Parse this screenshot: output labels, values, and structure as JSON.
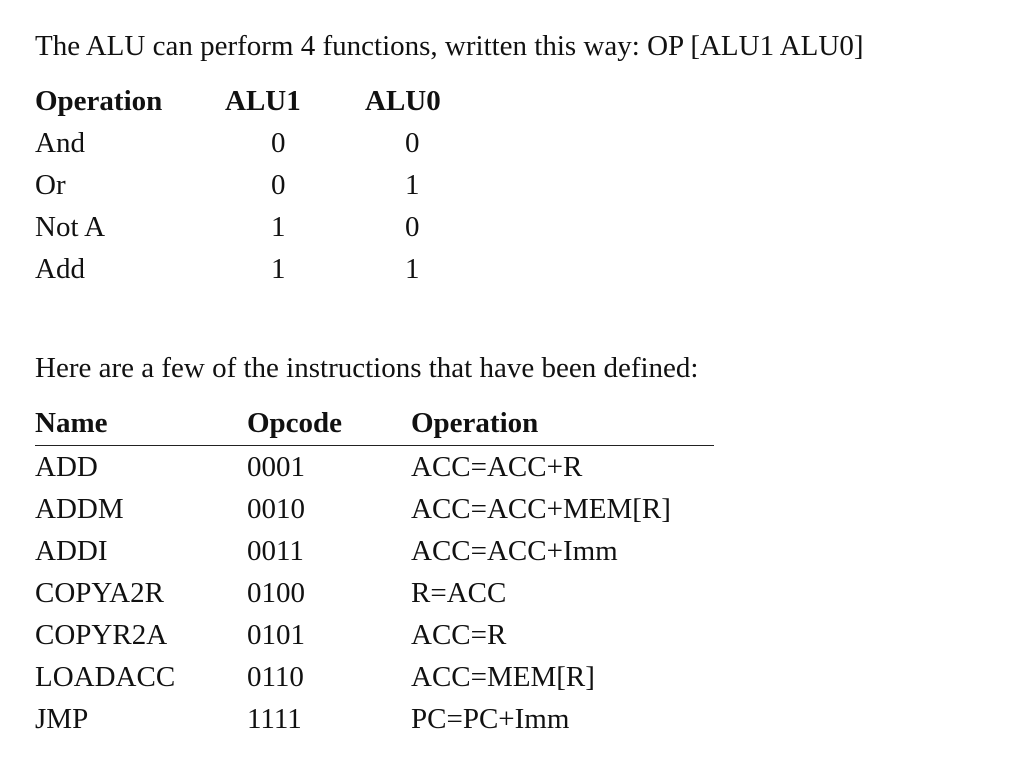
{
  "intro": {
    "alu_text": "The ALU can perform 4 functions, written this way:  OP [ALU1 ALU0]",
    "instr_text": "Here are a few of the instructions that have been defined:"
  },
  "alu_table": {
    "headers": [
      "Operation",
      "ALU1",
      "ALU0"
    ],
    "rows": [
      [
        "And",
        "0",
        "0"
      ],
      [
        "Or",
        "0",
        "1"
      ],
      [
        "Not A",
        "1",
        "0"
      ],
      [
        "Add",
        "1",
        "1"
      ]
    ]
  },
  "instr_table": {
    "headers": [
      "Name",
      "Opcode",
      "Operation"
    ],
    "rows": [
      [
        "ADD",
        "0001",
        "ACC=ACC+R"
      ],
      [
        "ADDM",
        "0010",
        "ACC=ACC+MEM[R]"
      ],
      [
        "ADDI",
        "0011",
        "ACC=ACC+Imm"
      ],
      [
        "COPYA2R",
        "0100",
        "R=ACC"
      ],
      [
        "COPYR2A",
        "0101",
        "ACC=R"
      ],
      [
        "LOADACC",
        "0110",
        "ACC=MEM[R]"
      ],
      [
        "JMP",
        "1111",
        "PC=PC+Imm"
      ]
    ]
  }
}
